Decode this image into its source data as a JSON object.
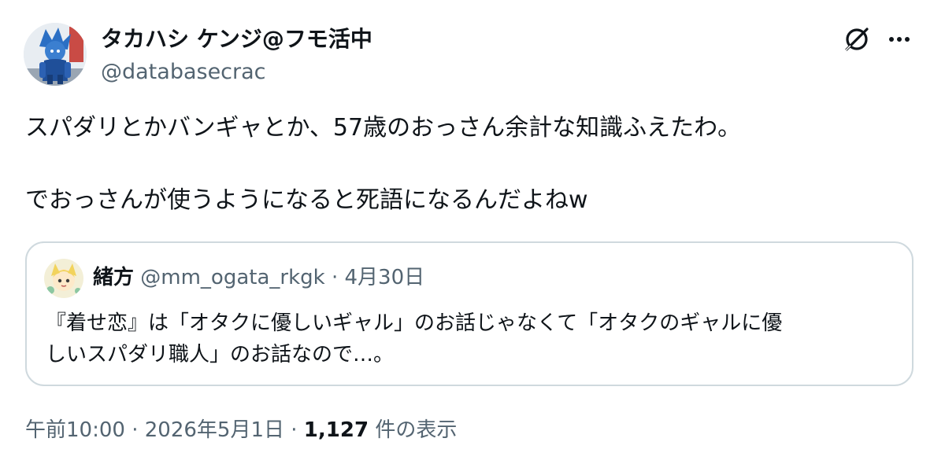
{
  "author": {
    "display_name": "タカハシ ケンジ@フモ活中",
    "handle": "@databasecrac"
  },
  "tweet": {
    "line1": "スパダリとかバンギャとか、57歳のおっさん余計な知識ふえたわ。",
    "line2": "でおっさんが使うようになると死語になるんだよねw"
  },
  "quote": {
    "name": "緒方",
    "handle": "@mm_ogata_rkgk",
    "separator": "·",
    "date": "4月30日",
    "line1": "『着せ恋』は「オタクに優しいギャル」のお話じゃなくて「オタクのギャルに優",
    "line2": "しいスパダリ職人」のお話なので…。"
  },
  "meta": {
    "time": "午前10:00",
    "sep1": "·",
    "date": "2026年5月1日",
    "sep2": "·",
    "views": "1,127",
    "views_label": "件の表示"
  },
  "icons": {
    "grok": "grok-icon",
    "more": "more-icon"
  },
  "colors": {
    "text": "#0f1419",
    "secondary": "#536471",
    "border": "#cfd9de"
  }
}
